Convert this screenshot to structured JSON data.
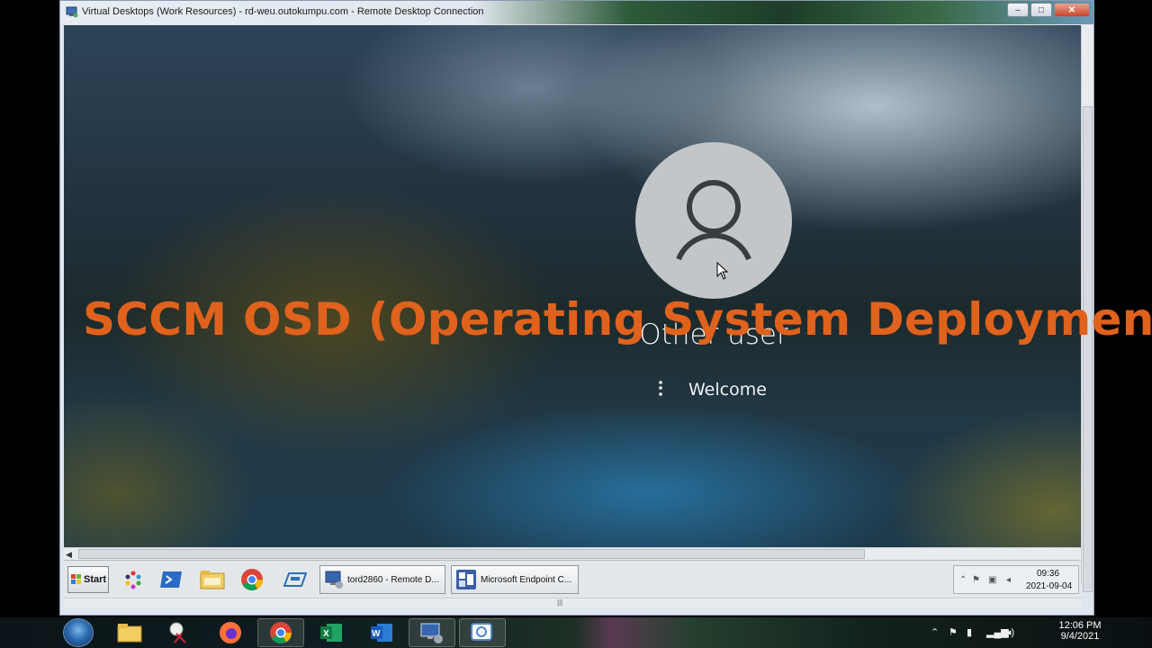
{
  "window": {
    "title": "Virtual Desktops (Work Resources) - rd-weu.outokumpu.com - Remote Desktop Connection",
    "min_label": "‒",
    "max_label": "□",
    "close_label": "✕"
  },
  "lock_screen": {
    "user_name": "Other user",
    "status_text": "Welcome"
  },
  "overlay": {
    "headline": "SCCM OSD (Operating System Deployment)",
    "color": "#e0621c"
  },
  "inner_taskbar": {
    "start_label": "Start",
    "pinned_icons": [
      "paint-icon",
      "powershell-icon",
      "folder-icon",
      "chrome-icon",
      "server-manager-icon"
    ],
    "tasks": [
      {
        "label": "tord2860 - Remote D...",
        "icon": "remote-desktop-icon"
      },
      {
        "label": "Microsoft Endpoint C...",
        "icon": "endpoint-manager-icon"
      }
    ],
    "tray": {
      "time": "09:36",
      "date": "2021-09-04"
    }
  },
  "host_taskbar": {
    "apps": [
      "explorer-icon",
      "snipping-tool-icon",
      "firefox-icon",
      "chrome-icon",
      "excel-icon",
      "word-icon",
      "remote-desktop-icon",
      "citrix-icon"
    ],
    "clock": {
      "time": "12:06 PM",
      "date": "9/4/2021"
    }
  }
}
